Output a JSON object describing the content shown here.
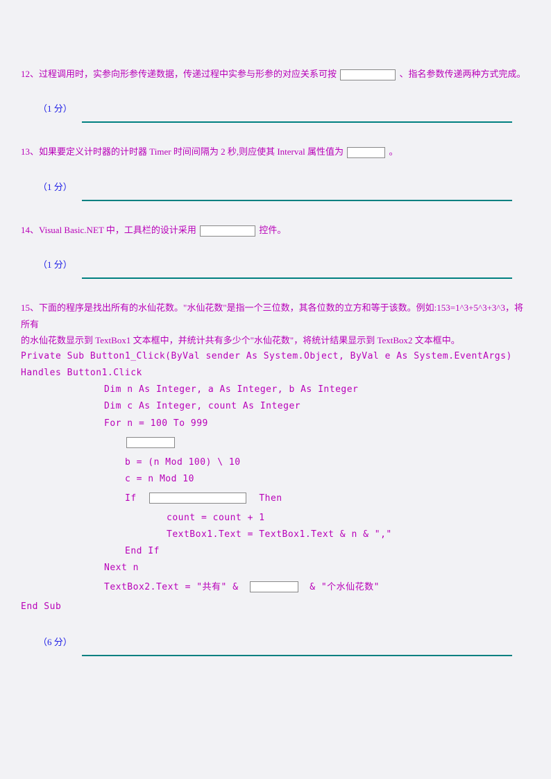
{
  "questions": {
    "q12": {
      "number": "12、",
      "text_before": "过程调用时，实参向形参传递数据，传递过程中实参与形参的对应关系可按",
      "text_after": "、指名参数传递两种方式完成。",
      "score": "（1 分）"
    },
    "q13": {
      "number": "13、",
      "text_before": "如果要定义计时器的计时器 Timer 时间间隔为 2 秒,则应使其 Interval 属性值为",
      "text_after": "。",
      "score": "（1 分）"
    },
    "q14": {
      "number": "14、",
      "text_before": "Visual  Basic.NET 中，工具栏的设计采用",
      "text_after": "控件。",
      "score": "（1 分）"
    },
    "q15": {
      "number": "15、",
      "intro_line1": "下面的程序是找出所有的水仙花数。\"水仙花数\"是指一个三位数，其各位数的立方和等于该数。例如:153=1^3+5^3+3^3，将所有",
      "intro_line2": "的水仙花数显示到 TextBox1 文本框中，并统计共有多少个\"水仙花数\"，将统计结果显示到 TextBox2 文本框中。",
      "code": {
        "line1": "Private  Sub  Button1_Click(ByVal  sender  As  System.Object,  ByVal  e  As  System.EventArgs)  Handles  Button1.Click",
        "line2": "Dim  n  As  Integer,  a  As  Integer,  b  As  Integer",
        "line3": "Dim  c  As  Integer,  count  As  Integer",
        "line4": "For  n  =  100  To  999",
        "line5_b": "b  =  (n  Mod  100)  \\  10",
        "line5_c": "c  =  n  Mod  10",
        "line6_if": "If",
        "line6_then": "Then",
        "line7": "count  =  count  +  1",
        "line8": "TextBox1.Text  =  TextBox1.Text  &  n  &  \",\"",
        "line9": "End  If",
        "line10": "Next  n",
        "line11_a": "TextBox2.Text  =  \"共有\"  &",
        "line11_b": "&  \"个水仙花数\"",
        "line12": "End  Sub"
      },
      "score": "（6 分）"
    }
  }
}
